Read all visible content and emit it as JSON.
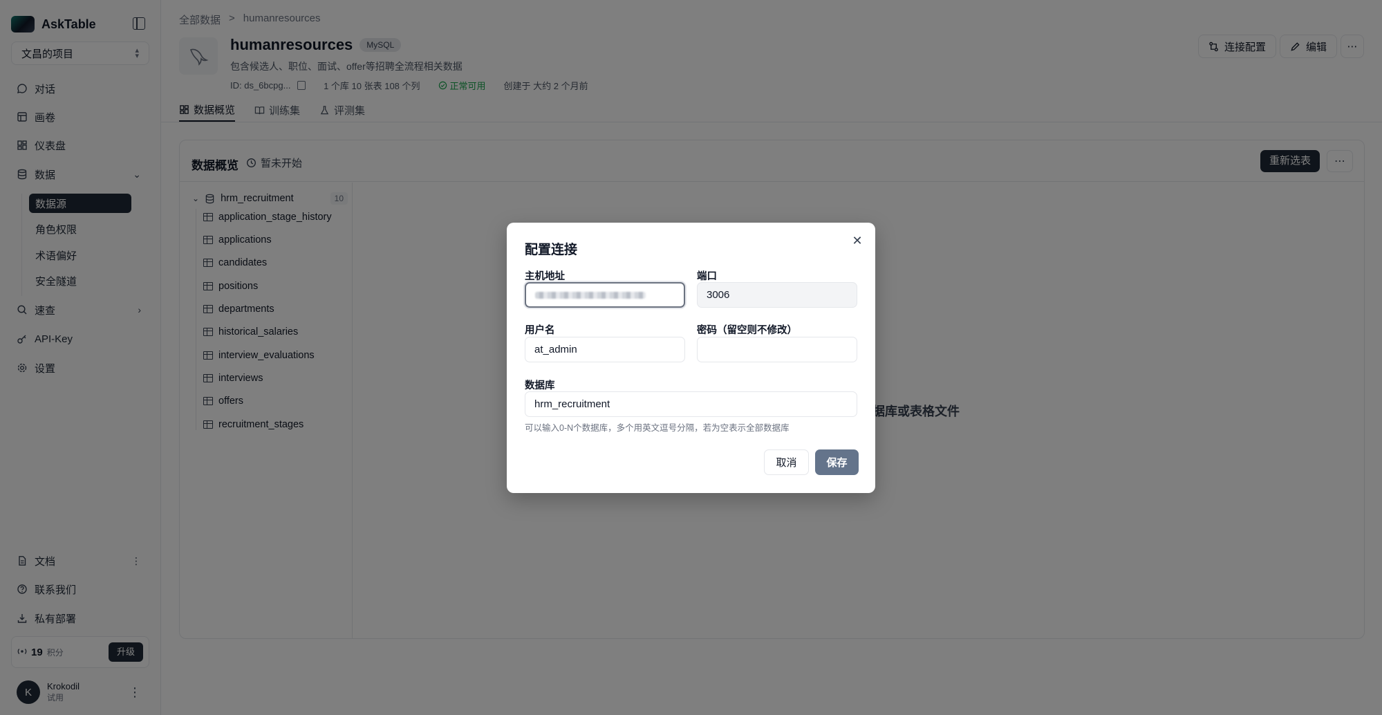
{
  "app": {
    "name": "AskTable"
  },
  "sidebar": {
    "project": "文昌的项目",
    "nav": [
      {
        "label": "对话"
      },
      {
        "label": "画卷"
      },
      {
        "label": "仪表盘"
      },
      {
        "label": "数据"
      }
    ],
    "data_sub": [
      {
        "label": "数据源"
      },
      {
        "label": "角色权限"
      },
      {
        "label": "术语偏好"
      },
      {
        "label": "安全隧道"
      }
    ],
    "nav2": [
      {
        "label": "速查"
      },
      {
        "label": "API-Key"
      },
      {
        "label": "设置"
      }
    ],
    "bottom": [
      {
        "label": "文档"
      },
      {
        "label": "联系我们"
      },
      {
        "label": "私有部署"
      }
    ],
    "points": {
      "value": "19",
      "unit": "积分",
      "upgrade": "升级"
    },
    "user": {
      "initial": "K",
      "name": "Krokodil",
      "tag": "试用"
    }
  },
  "breadcrumb": {
    "root": "全部数据",
    "sep": ">",
    "current": "humanresources"
  },
  "datasource": {
    "name": "humanresources",
    "engine": "MySQL",
    "description": "包含候选人、职位、面试、offer等招聘全流程相关数据",
    "id": "ID: ds_6bcpg...",
    "stats": "1 个库 10 张表 108 个列",
    "status": "正常可用",
    "created": "创建于 大约 2 个月前"
  },
  "header_actions": {
    "connect": "连接配置",
    "edit": "编辑"
  },
  "tabs": [
    {
      "label": "数据概览"
    },
    {
      "label": "训练集"
    },
    {
      "label": "评测集"
    }
  ],
  "overview": {
    "title": "数据概览",
    "status": "暂未开始",
    "reselect": "重新选表",
    "empty_hint": "据库或表格文件"
  },
  "tree": {
    "root": "hrm_recruitment",
    "count": "10",
    "tables": [
      "application_stage_history",
      "applications",
      "candidates",
      "positions",
      "departments",
      "historical_salaries",
      "interview_evaluations",
      "interviews",
      "offers",
      "recruitment_stages"
    ]
  },
  "modal": {
    "title": "配置连接",
    "host_label": "主机地址",
    "port_label": "端口",
    "port_value": "3006",
    "user_label": "用户名",
    "user_value": "at_admin",
    "password_label": "密码（留空则不修改）",
    "password_value": "",
    "db_label": "数据库",
    "db_value": "hrm_recruitment",
    "help": "可以输入0-N个数据库，多个用英文逗号分隔，若为空表示全部数据库",
    "cancel": "取消",
    "save": "保存"
  }
}
